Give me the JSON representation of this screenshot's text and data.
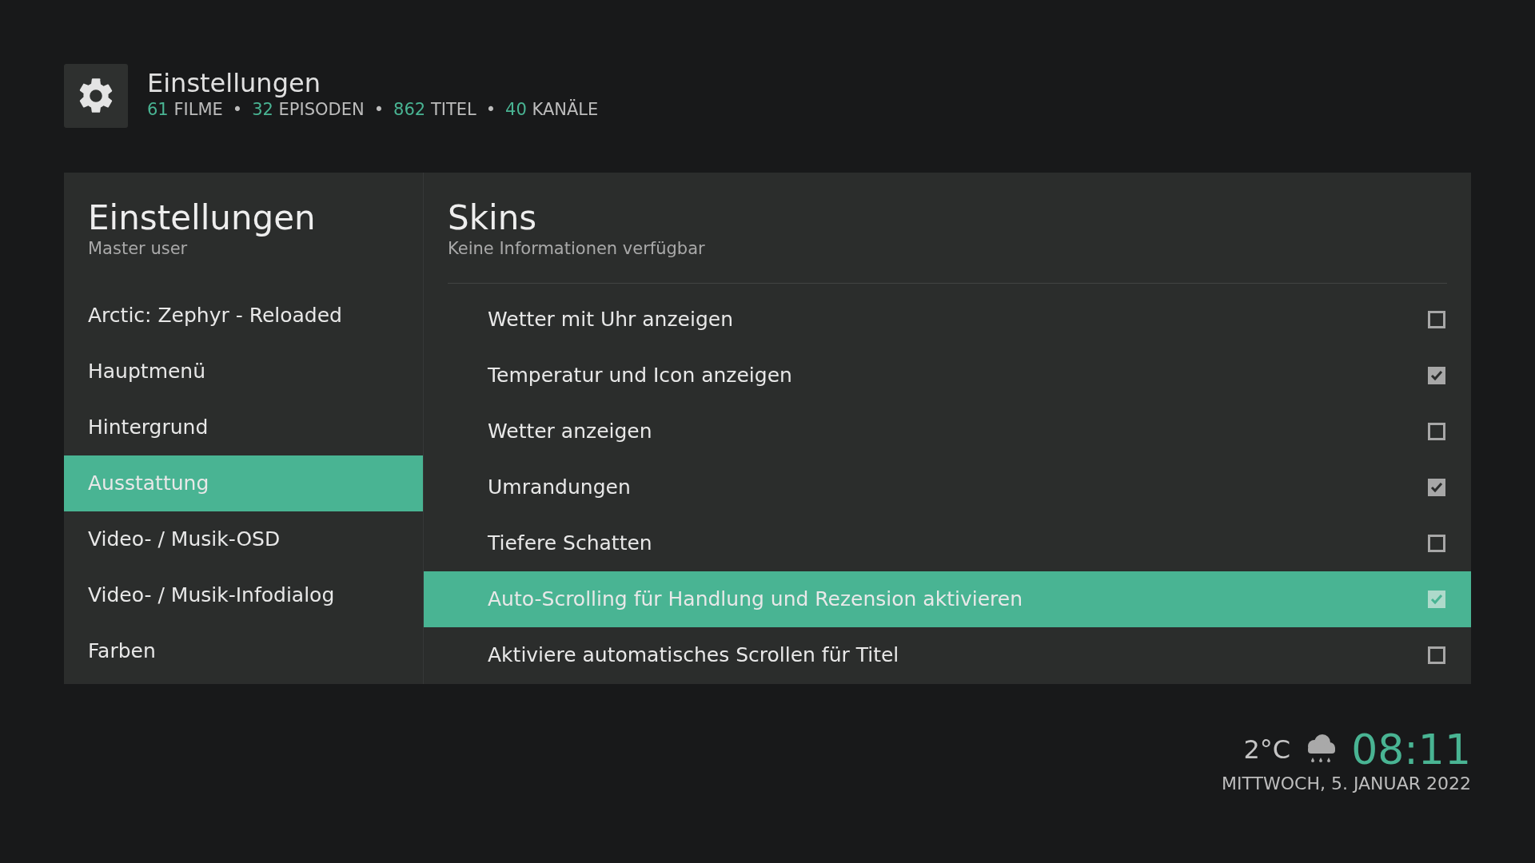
{
  "header": {
    "title": "Einstellungen",
    "stats": [
      {
        "kind": "stat",
        "count": "61",
        "label": "FILME"
      },
      {
        "kind": "separator",
        "text": "•"
      },
      {
        "kind": "stat",
        "count": "32",
        "label": "EPISODEN"
      },
      {
        "kind": "separator",
        "text": "•"
      },
      {
        "kind": "stat",
        "count": "862",
        "label": "TITEL"
      },
      {
        "kind": "separator",
        "text": "•"
      },
      {
        "kind": "stat",
        "count": "40",
        "label": "KANÄLE"
      }
    ]
  },
  "sidebar": {
    "title": "Einstellungen",
    "subtitle": "Master user",
    "items": [
      {
        "label": "Arctic: Zephyr - Reloaded",
        "selected": false
      },
      {
        "label": "Hauptmenü",
        "selected": false
      },
      {
        "label": "Hintergrund",
        "selected": false
      },
      {
        "label": "Ausstattung",
        "selected": true
      },
      {
        "label": "Video- / Musik-OSD",
        "selected": false
      },
      {
        "label": "Video- / Musik-Infodialog",
        "selected": false
      },
      {
        "label": "Farben",
        "selected": false
      }
    ]
  },
  "content": {
    "title": "Skins",
    "subtitle": "Keine Informationen verfügbar",
    "settings": [
      {
        "label": "Wetter mit Uhr anzeigen",
        "checked": false,
        "selected": false
      },
      {
        "label": "Temperatur und Icon anzeigen",
        "checked": true,
        "selected": false
      },
      {
        "label": "Wetter anzeigen",
        "checked": false,
        "selected": false
      },
      {
        "label": "Umrandungen",
        "checked": true,
        "selected": false
      },
      {
        "label": "Tiefere Schatten",
        "checked": false,
        "selected": false
      },
      {
        "label": "Auto-Scrolling für Handlung und Rezension aktivieren",
        "checked": true,
        "selected": true
      },
      {
        "label": "Aktiviere automatisches Scrollen für Titel",
        "checked": false,
        "selected": false
      }
    ]
  },
  "clock": {
    "temperature": "2°C",
    "time": "08:11",
    "date": "MITTWOCH, 5. JANUAR 2022"
  }
}
